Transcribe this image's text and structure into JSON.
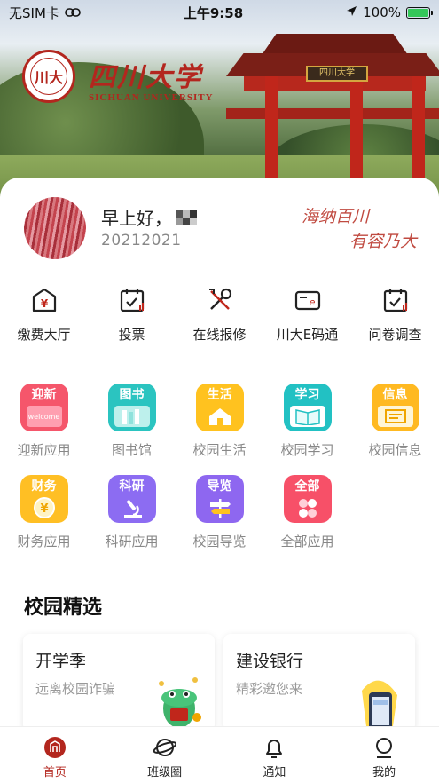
{
  "status_bar": {
    "carrier": "无SIM卡",
    "time": "上午9:58",
    "battery": "100%"
  },
  "header": {
    "logo_seal_text": "川大",
    "logo_cn": "四川大学",
    "logo_en": "SICHUAN UNIVERSITY",
    "gate_plaque": "四川大学"
  },
  "user": {
    "greeting": "早上好，",
    "student_id": "20212021",
    "motto_line1": "海纳百川",
    "motto_line2": "有容乃大"
  },
  "quick_actions": [
    {
      "label": "缴费大厅",
      "icon": "payment-house-icon"
    },
    {
      "label": "投票",
      "icon": "vote-calendar-icon"
    },
    {
      "label": "在线报修",
      "icon": "repair-tools-icon"
    },
    {
      "label": "川大E码通",
      "icon": "e-card-icon"
    },
    {
      "label": "问卷调查",
      "icon": "survey-calendar-icon"
    }
  ],
  "apps": [
    {
      "label": "迎新应用",
      "tile": "迎新",
      "art": "welcome",
      "color": "#f5566b"
    },
    {
      "label": "图书馆",
      "tile": "图书",
      "art": "books",
      "color": "#2bc4c0"
    },
    {
      "label": "校园生活",
      "tile": "生活",
      "art": "house",
      "color": "#ffc21f"
    },
    {
      "label": "校园学习",
      "tile": "学习",
      "art": "book",
      "color": "#22c1c3"
    },
    {
      "label": "校园信息",
      "tile": "信息",
      "art": "info",
      "color": "#ffb921"
    },
    {
      "label": "财务应用",
      "tile": "财务",
      "art": "coin",
      "color": "#ffbf24"
    },
    {
      "label": "科研应用",
      "tile": "科研",
      "art": "microscope",
      "color": "#8c6cf2"
    },
    {
      "label": "校园导览",
      "tile": "导览",
      "art": "signpost",
      "color": "#8e67f0"
    },
    {
      "label": "全部应用",
      "tile": "全部",
      "art": "grid",
      "color": "#f75068"
    }
  ],
  "section": {
    "title": "校园精选",
    "cards": [
      {
        "title": "开学季",
        "subtitle": "远离校园诈骗"
      },
      {
        "title": "建设银行",
        "subtitle": "精彩邀您来"
      }
    ]
  },
  "tabbar": [
    {
      "label": "首页",
      "active": true
    },
    {
      "label": "班级圈",
      "active": false
    },
    {
      "label": "通知",
      "active": false
    },
    {
      "label": "我的",
      "active": false
    }
  ],
  "colors": {
    "brand": "#b3261e",
    "accent_red": "#c04a40"
  }
}
